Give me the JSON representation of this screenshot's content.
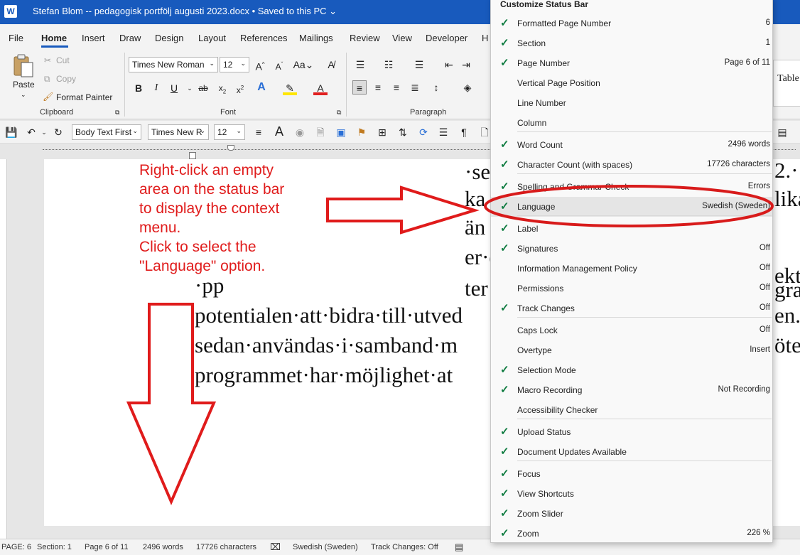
{
  "titlebar": {
    "app_icon": "W",
    "title": "Stefan Blom -- pedagogisk portfölj augusti 2023.docx • Saved to this PC ⌄"
  },
  "tabs": [
    "File",
    "Home",
    "Insert",
    "Draw",
    "Design",
    "Layout",
    "References",
    "Mailings",
    "Review",
    "View",
    "Developer",
    "H"
  ],
  "ribbon": {
    "paste": "Paste",
    "cut": "Cut",
    "copy": "Copy",
    "format_painter": "Format Painter",
    "clipboard_group": "Clipboard",
    "font_name": "Times New Roman",
    "font_size": "12",
    "font_group": "Font",
    "paragraph_group": "Paragraph",
    "table_partial": "Table"
  },
  "qat": {
    "style": "Body Text First",
    "font": "Times New R",
    "size": "12"
  },
  "document": {
    "lines_right": [
      "·se",
      "ka",
      "än",
      "er·c",
      "ter"
    ],
    "lines_right_edge": [
      "2.·",
      "lika",
      "",
      "ekt",
      "gram",
      "en.",
      "ötes"
    ],
    "line1": "potentialen·att·bidra·till·utved",
    "line2": "sedan·användas·i·samband·m",
    "line3": "programmet·har·möjlighet·at",
    "partial_top": "·pp"
  },
  "annotation": {
    "lines": [
      "Right-click an empty",
      "area on the status bar",
      "to display the context",
      "menu.",
      "Click to select the",
      "\"Language\" option."
    ],
    "color": "#e01b1b"
  },
  "statusbar": {
    "page": "PAGE: 6",
    "section": "Section: 1",
    "page_of": "Page 6 of 11",
    "words": "2496 words",
    "characters": "17726 characters",
    "language": "Swedish (Sweden)",
    "track_changes": "Track Changes: Off"
  },
  "context_menu": {
    "title": "Customize Status Bar",
    "items": [
      {
        "label": "Formatted Page Number",
        "value": "6",
        "checked": true
      },
      {
        "label": "Section",
        "value": "1",
        "checked": true
      },
      {
        "label": "Page Number",
        "value": "Page 6 of 11",
        "checked": true
      },
      {
        "label": "Vertical Page Position",
        "value": "",
        "checked": false
      },
      {
        "label": "Line Number",
        "value": "",
        "checked": false
      },
      {
        "label": "Column",
        "value": "",
        "checked": false
      },
      {
        "label": "Word Count",
        "value": "2496 words",
        "checked": true
      },
      {
        "label": "Character Count (with spaces)",
        "value": "17726 characters",
        "checked": true
      },
      {
        "label": "Spelling and Grammar Check",
        "value": "Errors",
        "checked": true
      },
      {
        "label": "Language",
        "value": "Swedish (Sweden)",
        "checked": true
      },
      {
        "label": "Label",
        "value": "",
        "checked": true
      },
      {
        "label": "Signatures",
        "value": "Off",
        "checked": true
      },
      {
        "label": "Information Management Policy",
        "value": "Off",
        "checked": false
      },
      {
        "label": "Permissions",
        "value": "Off",
        "checked": false
      },
      {
        "label": "Track Changes",
        "value": "Off",
        "checked": true
      },
      {
        "label": "Caps Lock",
        "value": "Off",
        "checked": false
      },
      {
        "label": "Overtype",
        "value": "Insert",
        "checked": false
      },
      {
        "label": "Selection Mode",
        "value": "",
        "checked": true
      },
      {
        "label": "Macro Recording",
        "value": "Not Recording",
        "checked": true
      },
      {
        "label": "Accessibility Checker",
        "value": "",
        "checked": false
      },
      {
        "label": "Upload Status",
        "value": "",
        "checked": true
      },
      {
        "label": "Document Updates Available",
        "value": "",
        "checked": true
      },
      {
        "label": "Focus",
        "value": "",
        "checked": true
      },
      {
        "label": "View Shortcuts",
        "value": "",
        "checked": true
      },
      {
        "label": "Zoom Slider",
        "value": "",
        "checked": true
      },
      {
        "label": "Zoom",
        "value": "226 %",
        "checked": true
      }
    ]
  },
  "colors": {
    "word_blue": "#185abd",
    "check_green": "#107c41",
    "annotation_red": "#e01b1b"
  }
}
